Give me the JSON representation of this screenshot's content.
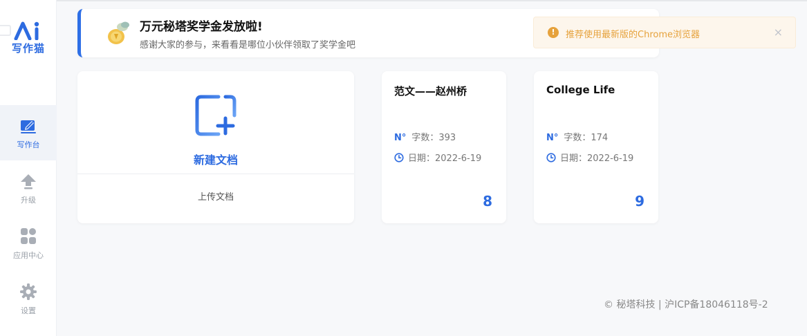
{
  "app": {
    "logo_text": "写作猫"
  },
  "sidebar": {
    "items": [
      {
        "label": "写作台",
        "icon": "edit-icon",
        "active": true
      },
      {
        "label": "升级",
        "icon": "upload-arrow-icon"
      },
      {
        "label": "应用中心",
        "icon": "grid-apps-icon"
      },
      {
        "label": "设置",
        "icon": "gear-icon"
      }
    ]
  },
  "banner": {
    "title": "万元秘塔奖学金发放啦!",
    "subtitle": "感谢大家的参与，来看看是哪位小伙伴领取了奖学金吧",
    "icon": "coins-icon"
  },
  "toast": {
    "text": "推荐使用最新版的Chrome浏览器",
    "icon": "warning-icon",
    "close": "×"
  },
  "new_doc": {
    "label": "新建文档",
    "upload_label": "上传文档"
  },
  "documents": [
    {
      "title": "范文——赵州桥",
      "word_count_label": "字数：393",
      "date_label": "日期：2022-6-19",
      "count": "8"
    },
    {
      "title": "College Life",
      "word_count_label": "字数：174",
      "date_label": "日期：2022-6-19",
      "count": "9"
    }
  ],
  "footer": {
    "text": "© 秘塔科技 | 沪ICP备18046118号-2"
  },
  "colors": {
    "accent": "#2d6be0",
    "warning": "#e6a23c",
    "warning_bg": "#fdf6ec"
  }
}
